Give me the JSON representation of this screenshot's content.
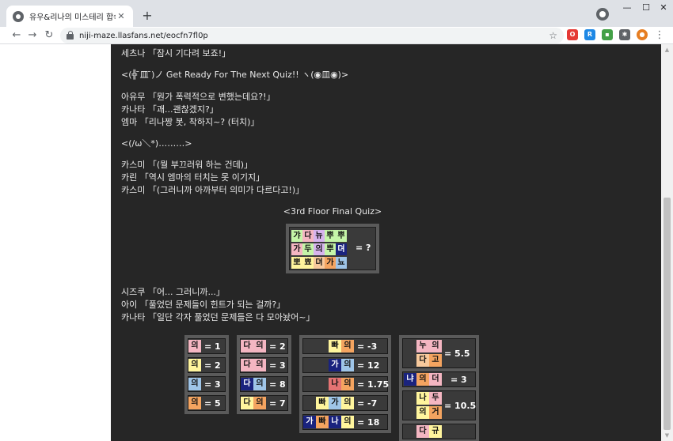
{
  "browser": {
    "tab_title": "유우&리나의 미스테리 합숙",
    "tab_close": "✕",
    "new_tab": "+",
    "url": "niji-maze.llasfans.net/eocfn7fl0p",
    "back": "←",
    "forward": "→",
    "reload": "↻",
    "star": "☆",
    "menu": "⋮",
    "minimize": "—",
    "maximize": "☐",
    "close": "✕",
    "extensions": [
      {
        "label": "O",
        "color": "#e53935"
      },
      {
        "label": "R",
        "color": "#1e88e5"
      },
      {
        "label": "▪",
        "color": "#43a047"
      },
      {
        "label": "✱",
        "color": "#5f6368"
      },
      {
        "label": "●",
        "color": "#e67e22"
      }
    ]
  },
  "page": {
    "lines_top": [
      "세츠나 「잠시 기다려 보죠!」",
      "<(╬ ̄皿 ̄)ノ  Get Ready For The Next Quiz!!  ヽ(◉皿◉)>",
      "아유무 「뭔가 폭력적으로 변했는데요?!」",
      "카나타 「괘...괜찮겠지?」",
      "엠마 「리나짱 봇, 착하지~? (터치)」",
      "<(/ω＼*)………>",
      "카스미 「(뭘 부끄러워 하는 건데)」",
      "카린 「역시 엠마의 터치는 못 이기지」",
      "카스미 「(그러니까 아까부터 의미가 다르다고!)」"
    ],
    "final_title": "<3rd Floor Final Quiz>",
    "final_rows": [
      [
        {
          "t": "갸",
          "c": "#c5f5a8"
        },
        {
          "t": "다",
          "c": "#f4b6c2"
        },
        {
          "t": "뉴",
          "c": "#d7b4ee"
        },
        {
          "t": "뿌",
          "c": "#c5f5a8"
        },
        {
          "t": "뿌",
          "c": "#c5f5a8"
        }
      ],
      [
        {
          "t": "가",
          "c": "#f4b6c2"
        },
        {
          "t": "두",
          "c": "#c5f5a8"
        },
        {
          "t": "의",
          "c": "#d7b4ee"
        },
        {
          "t": "뿌",
          "c": "#c5f5a8"
        },
        {
          "t": "뎌",
          "c": "#1a237e",
          "dark": true
        }
      ],
      [
        {
          "t": "뽀",
          "c": "#fff59d"
        },
        {
          "t": "뾰",
          "c": "#fff59d"
        },
        {
          "t": "뎌",
          "c": "#f7c99c"
        },
        {
          "t": "가",
          "c": "#f4a460"
        },
        {
          "t": "뇨",
          "c": "#9fc5e8"
        }
      ]
    ],
    "final_answer": "=  ?",
    "lines_bottom": [
      "시즈쿠 「어... 그러니까...」",
      "아이 「풀었던 문제들이 힌트가 되는 걸까?」",
      "카나타 「일단 각자 풀었던 문제들은 다 모아놨어~」"
    ],
    "hints_col1": [
      {
        "cells": [
          {
            "t": "의",
            "c": "#f4b6c2"
          }
        ],
        "val": "=   1"
      },
      {
        "cells": [
          {
            "t": "의",
            "c": "#fff59d"
          }
        ],
        "val": "=   2"
      },
      {
        "cells": [
          {
            "t": "의",
            "c": "#9fc5e8"
          }
        ],
        "val": "=   3"
      },
      {
        "cells": [
          {
            "t": "의",
            "c": "#f4a460"
          }
        ],
        "val": "=   5"
      }
    ],
    "hints_col2": [
      {
        "cells": [
          {
            "t": "다",
            "c": "#f4b6c2"
          },
          {
            "t": "의",
            "c": "#f4b6c2"
          }
        ],
        "val": "=   2"
      },
      {
        "cells": [
          {
            "t": "다",
            "c": "#f4b6c2"
          },
          {
            "t": "의",
            "c": "#f4b6c2"
          }
        ],
        "val": "=   3"
      },
      {
        "cells": [
          {
            "t": "다",
            "c": "#1a237e",
            "dark": true
          },
          {
            "t": "의",
            "c": "#9fc5e8"
          }
        ],
        "val": "=   8"
      },
      {
        "cells": [
          {
            "t": "다",
            "c": "#fff59d"
          },
          {
            "t": "의",
            "c": "#f4a460"
          }
        ],
        "val": "=   7"
      }
    ],
    "hints_col3": [
      {
        "cells": [
          {
            "t": "빠",
            "c": "#fff59d"
          },
          {
            "t": "의",
            "c": "#f4a460"
          }
        ],
        "val": "=    -3"
      },
      {
        "cells": [
          {
            "t": "가",
            "c": "#1a237e",
            "dark": true
          },
          {
            "t": "의",
            "c": "#9fc5e8"
          }
        ],
        "val": "=    12"
      },
      {
        "cells": [
          {
            "t": "나",
            "c": "#e57373"
          },
          {
            "t": "의",
            "c": "#f4a460"
          }
        ],
        "val": "=   1.75"
      },
      {
        "cells": [
          {
            "t": "빠",
            "c": "#fff59d"
          },
          {
            "t": "가",
            "c": "#9fc5e8"
          },
          {
            "t": "의",
            "c": "#fff59d"
          }
        ],
        "val": "=    -7"
      },
      {
        "cells": [
          {
            "t": "가",
            "c": "#1a237e",
            "dark": true
          },
          {
            "t": "빠",
            "c": "#f4a460"
          },
          {
            "t": "나",
            "c": "#1a237e",
            "dark": true
          },
          {
            "t": "의",
            "c": "#fff59d"
          }
        ],
        "val": "=    18"
      }
    ],
    "hints_col4": [
      {
        "cells": [
          {
            "t": "누",
            "c": "#f4b6c2"
          },
          {
            "t": "의",
            "c": "#f4b6c2"
          },
          {
            "t": "다",
            "c": "#f7c99c"
          },
          {
            "t": "고",
            "c": "#f4a460"
          }
        ],
        "val": "=   5.5",
        "tall": true
      },
      {
        "cells": [
          {
            "t": "냐",
            "c": "#1a237e",
            "dark": true
          },
          {
            "t": "의",
            "c": "#f4a460"
          },
          {
            "t": "더",
            "c": "#f4b6c2"
          }
        ],
        "val": "=    3"
      },
      {
        "cells": [
          {
            "t": "나",
            "c": "#fff59d"
          },
          {
            "t": "두",
            "c": "#f4b6c2"
          },
          {
            "t": "의",
            "c": "#fff59d"
          },
          {
            "t": "거",
            "c": "#f4a460"
          }
        ],
        "val": "=  10.5",
        "tall": true
      },
      {
        "cells": [
          {
            "t": "다",
            "c": "#f4b6c2"
          },
          {
            "t": "규",
            "c": "#fff59d"
          }
        ],
        "val": "",
        "tall": false
      }
    ]
  }
}
